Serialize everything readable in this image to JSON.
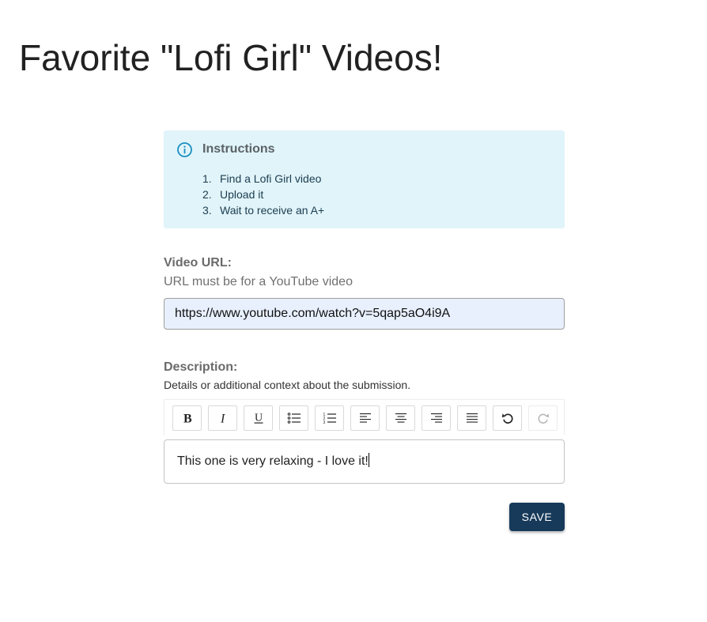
{
  "page": {
    "title": "Favorite \"Lofi Girl\" Videos!"
  },
  "instructions": {
    "title": "Instructions",
    "icon": "info-icon",
    "items": [
      {
        "num": "1.",
        "text": "Find a Lofi Girl video"
      },
      {
        "num": "2.",
        "text": "Upload it"
      },
      {
        "num": "3.",
        "text": "Wait to receive an A+"
      }
    ]
  },
  "video_url": {
    "label": "Video URL:",
    "hint": "URL must be for a YouTube video",
    "value": "https://www.youtube.com/watch?v=5qap5aO4i9A"
  },
  "description": {
    "label": "Description:",
    "hint": "Details or additional context about the submission.",
    "value": "This one is very relaxing - I love it!",
    "toolbar": [
      "bold-icon",
      "italic-icon",
      "underline-icon",
      "bulleted-list-icon",
      "numbered-list-icon",
      "align-left-icon",
      "align-center-icon",
      "align-right-icon",
      "align-justify-icon",
      "undo-icon",
      "redo-icon"
    ]
  },
  "actions": {
    "save_label": "SAVE"
  },
  "colors": {
    "info_background": "#e0f4fa",
    "info_icon": "#1a8fc1",
    "input_background": "#e8f0fe",
    "save_button": "#173a5a"
  }
}
